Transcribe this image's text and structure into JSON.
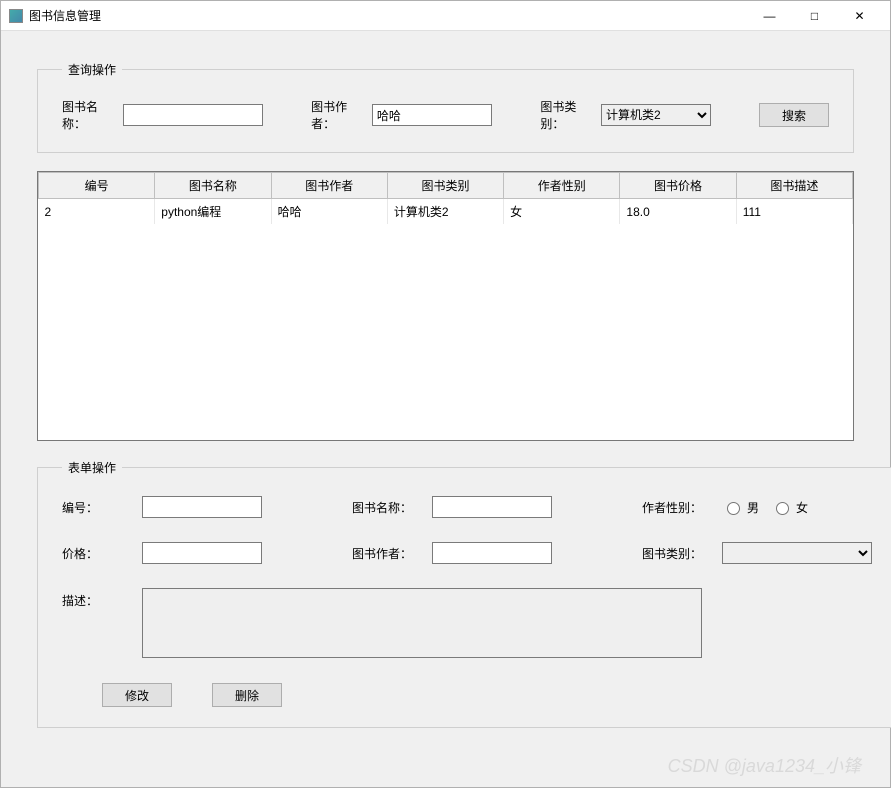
{
  "window": {
    "title": "图书信息管理",
    "min_icon": "—",
    "max_icon": "□",
    "close_icon": "✕"
  },
  "search": {
    "group_title": "查询操作",
    "name_label": "图书名称：",
    "name_value": "",
    "author_label": "图书作者：",
    "author_value": "哈哈",
    "category_label": "图书类别：",
    "category_value": "计算机类2",
    "search_label": "搜索"
  },
  "table": {
    "columns": [
      "编号",
      "图书名称",
      "图书作者",
      "图书类别",
      "作者性别",
      "图书价格",
      "图书描述"
    ],
    "rows": [
      {
        "id": "2",
        "name": "python编程",
        "author": "哈哈",
        "category": "计算机类2",
        "gender": "女",
        "price": "18.0",
        "desc": "111"
      }
    ]
  },
  "form": {
    "group_title": "表单操作",
    "id_label": "编号：",
    "id_value": "",
    "name_label": "图书名称：",
    "name_value": "",
    "gender_label": "作者性别：",
    "gender_male": "男",
    "gender_female": "女",
    "price_label": "价格：",
    "price_value": "",
    "author_label": "图书作者：",
    "author_value": "",
    "category_label": "图书类别：",
    "category_value": "",
    "desc_label": "描述：",
    "desc_value": "",
    "modify_label": "修改",
    "delete_label": "删除"
  },
  "watermark": "CSDN @java1234_小锋"
}
